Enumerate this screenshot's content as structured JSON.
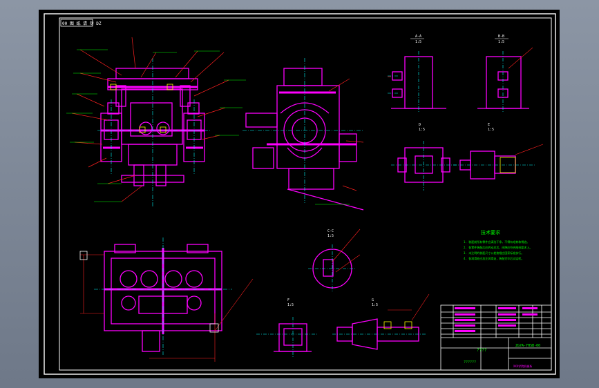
{
  "drawing": {
    "title_tag": "00 图 纸 请 勿 DZ",
    "tech_req_title": "技术要求",
    "tech_req_lines": [
      "1. 装配前所有零件应清洗干净，不得有毛刺和锈迹。",
      "2. 各零件装配后应转动灵活，间隙应符合图纸要求上。",
      "3. 未注明的装配尺寸公差按相应国家标准执行。",
      "4. 各润滑处应加注润滑油，装配完毕后试运转。"
    ],
    "title_block": {
      "name": "????",
      "drawing_no": "ZG7A-YHSB-00",
      "company": "??????",
      "school": "XXX学院机械系"
    },
    "section_labels": {
      "a_a": "A-A",
      "a_a_sub": "1:5",
      "b_b": "B-B",
      "b_b_sub": "1:5",
      "c_c": "C-C",
      "c_c_sub": "1:5",
      "d_d": "D",
      "d_d_sub": "1:5",
      "e_e": "E",
      "e_e_sub": "1:5",
      "f_f": "F",
      "f_f_sub": "1:5",
      "g_g": "G",
      "g_g_sub": "1:5"
    }
  },
  "colors": {
    "background": "#000000",
    "frame": "#ffffff",
    "part": "#ff00ff",
    "annotation": "#00ff00",
    "leader": "#ff2020",
    "centerline": "#00ffff",
    "highlight": "#ffff00"
  }
}
